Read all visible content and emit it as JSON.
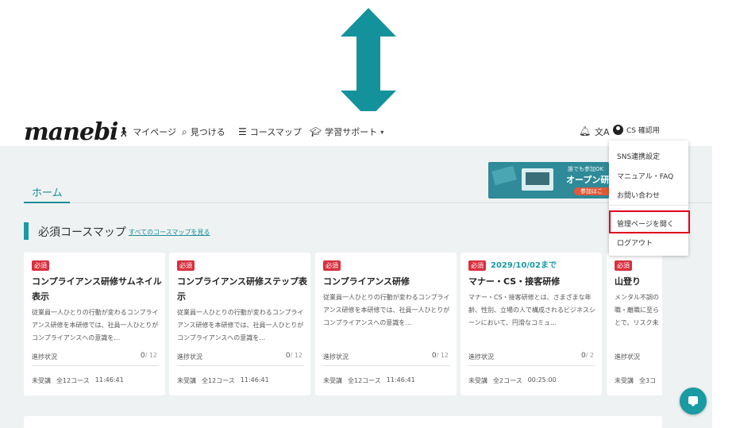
{
  "colors": {
    "accent": "#1a9aa3",
    "required_badge": "#d9303e",
    "highlight_border": "#e0001b",
    "arrow": "#14929c"
  },
  "header": {
    "logo": "manebi",
    "nav": [
      {
        "label": "マイページ",
        "icon": "person-icon"
      },
      {
        "label": "見つける",
        "icon": "search-icon"
      },
      {
        "label": "コースマップ",
        "icon": "list-icon"
      },
      {
        "label": "学習サポート",
        "icon": "graduation-cap-icon"
      }
    ],
    "right_icons": [
      "bell-icon",
      "translate-icon"
    ],
    "user_name": "CS 確認用"
  },
  "tabs": {
    "home": "ホーム"
  },
  "banner": {
    "line1": "誰でも参加OK",
    "line2": "オープン研",
    "button": "参加はこ"
  },
  "section": {
    "title": "必須コースマップ",
    "link": "すべてのコースマップを見る"
  },
  "cards": [
    {
      "badge": "必須",
      "deadline": "",
      "title": "コンプライアンス研修サムネイル表示",
      "desc": "従業員一人ひとりの行動が変わるコンプライアンス研修を本研修では、社員一人ひとりがコンプライアンスへの意識を…",
      "progress_label": "進捗状況",
      "progress_done": "0",
      "progress_total": "/ 12",
      "progress": 0,
      "status": "未受講",
      "course_count": "全12コース",
      "duration": "11:46:41"
    },
    {
      "badge": "必須",
      "deadline": "",
      "title": "コンプライアンス研修ステップ表示",
      "desc": "従業員一人ひとりの行動が変わるコンプライアンス研修を本研修では、社員一人ひとりがコンプライアンスへの意識を…",
      "progress_label": "進捗状況",
      "progress_done": "0",
      "progress_total": "/ 12",
      "progress": 0,
      "status": "未受講",
      "course_count": "全12コース",
      "duration": "11:46:41"
    },
    {
      "badge": "必須",
      "deadline": "",
      "title": "コンプライアンス研修",
      "desc": "従業員一人ひとりの行動が変わるコンプライアンス研修を本研修では、社員一人ひとりがコンプライアンスへの意識を…",
      "progress_label": "進捗状況",
      "progress_done": "0",
      "progress_total": "/ 12",
      "progress": 0,
      "status": "未受講",
      "course_count": "全12コース",
      "duration": "11:46:41"
    },
    {
      "badge": "必須",
      "deadline": "2029/10/02まで",
      "title": "マナー・CS・接客研修",
      "desc": "マナー・CS・接客研修とは、さまざまな年齢、性別、立場の人で構成されるビジネスシーンにおいて、円滑なコミュ…",
      "progress_label": "進捗状況",
      "progress_done": "0",
      "progress_total": "/ 2",
      "progress": 0,
      "status": "未受講",
      "course_count": "全2コース",
      "duration": "00:25:00"
    },
    {
      "badge": "必須",
      "deadline": "",
      "title": "山登り",
      "desc": "メンタル不調の職・離職に至らとで、リスク未",
      "progress_label": "進捗状況",
      "progress_done": "",
      "progress_total": "",
      "progress": 0,
      "status": "未受講",
      "course_count": "全3コ",
      "duration": ""
    }
  ],
  "dropdown": {
    "items": [
      "SNS連携設定",
      "マニュアル・FAQ",
      "お問い合わせ",
      "管理ページを開く",
      "ログアウト"
    ],
    "highlighted": "管理ページを開く"
  },
  "chat": {
    "icon": "chat-icon"
  }
}
